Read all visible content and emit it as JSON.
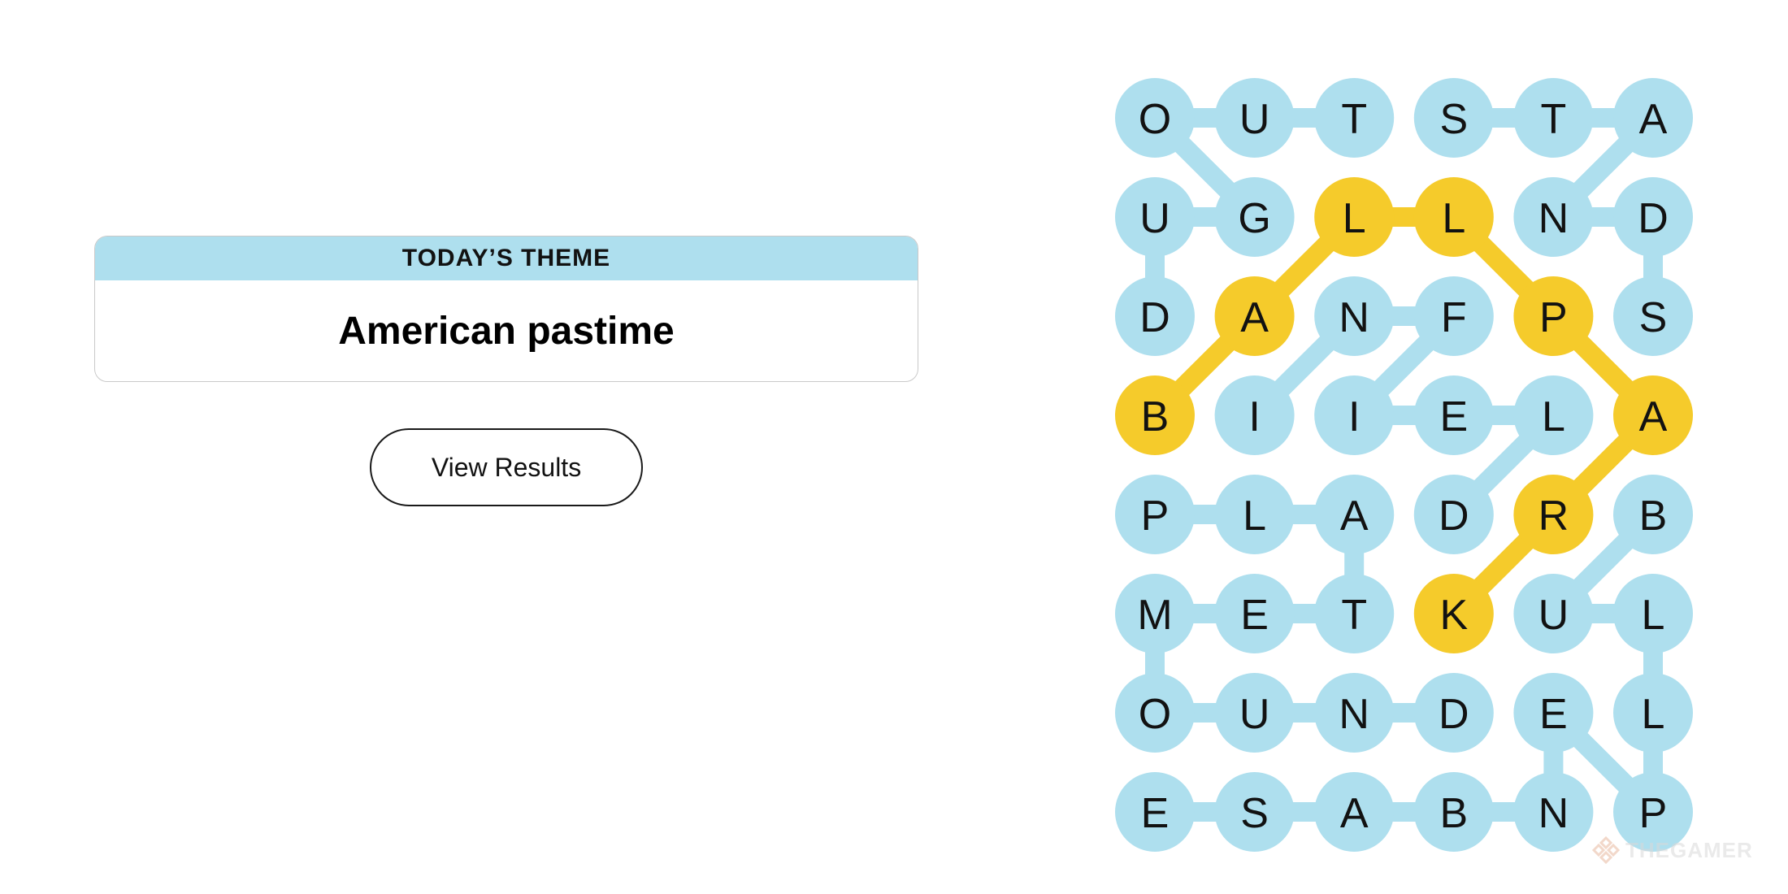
{
  "theme": {
    "header": "TODAY’S THEME",
    "title": "American pastime"
  },
  "button": {
    "view_results_label": "View Results"
  },
  "board": {
    "rows": [
      [
        "O",
        "U",
        "T",
        "S",
        "T",
        "A"
      ],
      [
        "U",
        "G",
        "L",
        "L",
        "N",
        "D"
      ],
      [
        "D",
        "A",
        "N",
        "F",
        "P",
        "S"
      ],
      [
        "B",
        "I",
        "I",
        "E",
        "L",
        "A"
      ],
      [
        "P",
        "L",
        "A",
        "D",
        "R",
        "B"
      ],
      [
        "M",
        "E",
        "T",
        "K",
        "U",
        "L"
      ],
      [
        "O",
        "U",
        "N",
        "D",
        "E",
        "L"
      ],
      [
        "E",
        "S",
        "A",
        "B",
        "N",
        "P"
      ]
    ],
    "spangram_cells": [
      [
        3,
        0
      ],
      [
        2,
        1
      ],
      [
        1,
        2
      ],
      [
        1,
        3
      ],
      [
        2,
        4
      ],
      [
        3,
        5
      ],
      [
        4,
        4
      ],
      [
        5,
        3
      ]
    ],
    "found_links": [
      [
        [
          0,
          0
        ],
        [
          0,
          1
        ]
      ],
      [
        [
          0,
          1
        ],
        [
          0,
          2
        ]
      ],
      [
        [
          0,
          0
        ],
        [
          1,
          1
        ]
      ],
      [
        [
          1,
          0
        ],
        [
          1,
          1
        ]
      ],
      [
        [
          1,
          0
        ],
        [
          2,
          0
        ]
      ],
      [
        [
          0,
          3
        ],
        [
          0,
          4
        ]
      ],
      [
        [
          0,
          4
        ],
        [
          0,
          5
        ]
      ],
      [
        [
          0,
          5
        ],
        [
          1,
          4
        ]
      ],
      [
        [
          1,
          4
        ],
        [
          1,
          5
        ]
      ],
      [
        [
          1,
          5
        ],
        [
          2,
          5
        ]
      ],
      [
        [
          2,
          2
        ],
        [
          2,
          3
        ]
      ],
      [
        [
          2,
          2
        ],
        [
          3,
          1
        ]
      ],
      [
        [
          2,
          3
        ],
        [
          3,
          2
        ]
      ],
      [
        [
          3,
          2
        ],
        [
          3,
          3
        ]
      ],
      [
        [
          3,
          3
        ],
        [
          3,
          4
        ]
      ],
      [
        [
          3,
          4
        ],
        [
          4,
          3
        ]
      ],
      [
        [
          4,
          0
        ],
        [
          4,
          1
        ]
      ],
      [
        [
          4,
          1
        ],
        [
          4,
          2
        ]
      ],
      [
        [
          4,
          2
        ],
        [
          5,
          2
        ]
      ],
      [
        [
          5,
          2
        ],
        [
          5,
          1
        ]
      ],
      [
        [
          5,
          1
        ],
        [
          5,
          0
        ]
      ],
      [
        [
          5,
          0
        ],
        [
          6,
          0
        ]
      ],
      [
        [
          6,
          0
        ],
        [
          6,
          1
        ]
      ],
      [
        [
          6,
          1
        ],
        [
          6,
          2
        ]
      ],
      [
        [
          6,
          2
        ],
        [
          6,
          3
        ]
      ],
      [
        [
          7,
          0
        ],
        [
          7,
          1
        ]
      ],
      [
        [
          7,
          1
        ],
        [
          7,
          2
        ]
      ],
      [
        [
          7,
          2
        ],
        [
          7,
          3
        ]
      ],
      [
        [
          7,
          3
        ],
        [
          7,
          4
        ]
      ],
      [
        [
          4,
          5
        ],
        [
          5,
          4
        ]
      ],
      [
        [
          5,
          4
        ],
        [
          5,
          5
        ]
      ],
      [
        [
          5,
          5
        ],
        [
          6,
          5
        ]
      ],
      [
        [
          6,
          5
        ],
        [
          7,
          5
        ]
      ],
      [
        [
          7,
          5
        ],
        [
          6,
          4
        ]
      ],
      [
        [
          6,
          4
        ],
        [
          7,
          4
        ]
      ]
    ]
  },
  "watermark": {
    "label": "THEGAMER",
    "icon": "thegamer-logo-icon"
  },
  "colors": {
    "theme_blue": "#aedfee",
    "spangram_yellow": "#f5cb2b",
    "text": "#121212"
  }
}
